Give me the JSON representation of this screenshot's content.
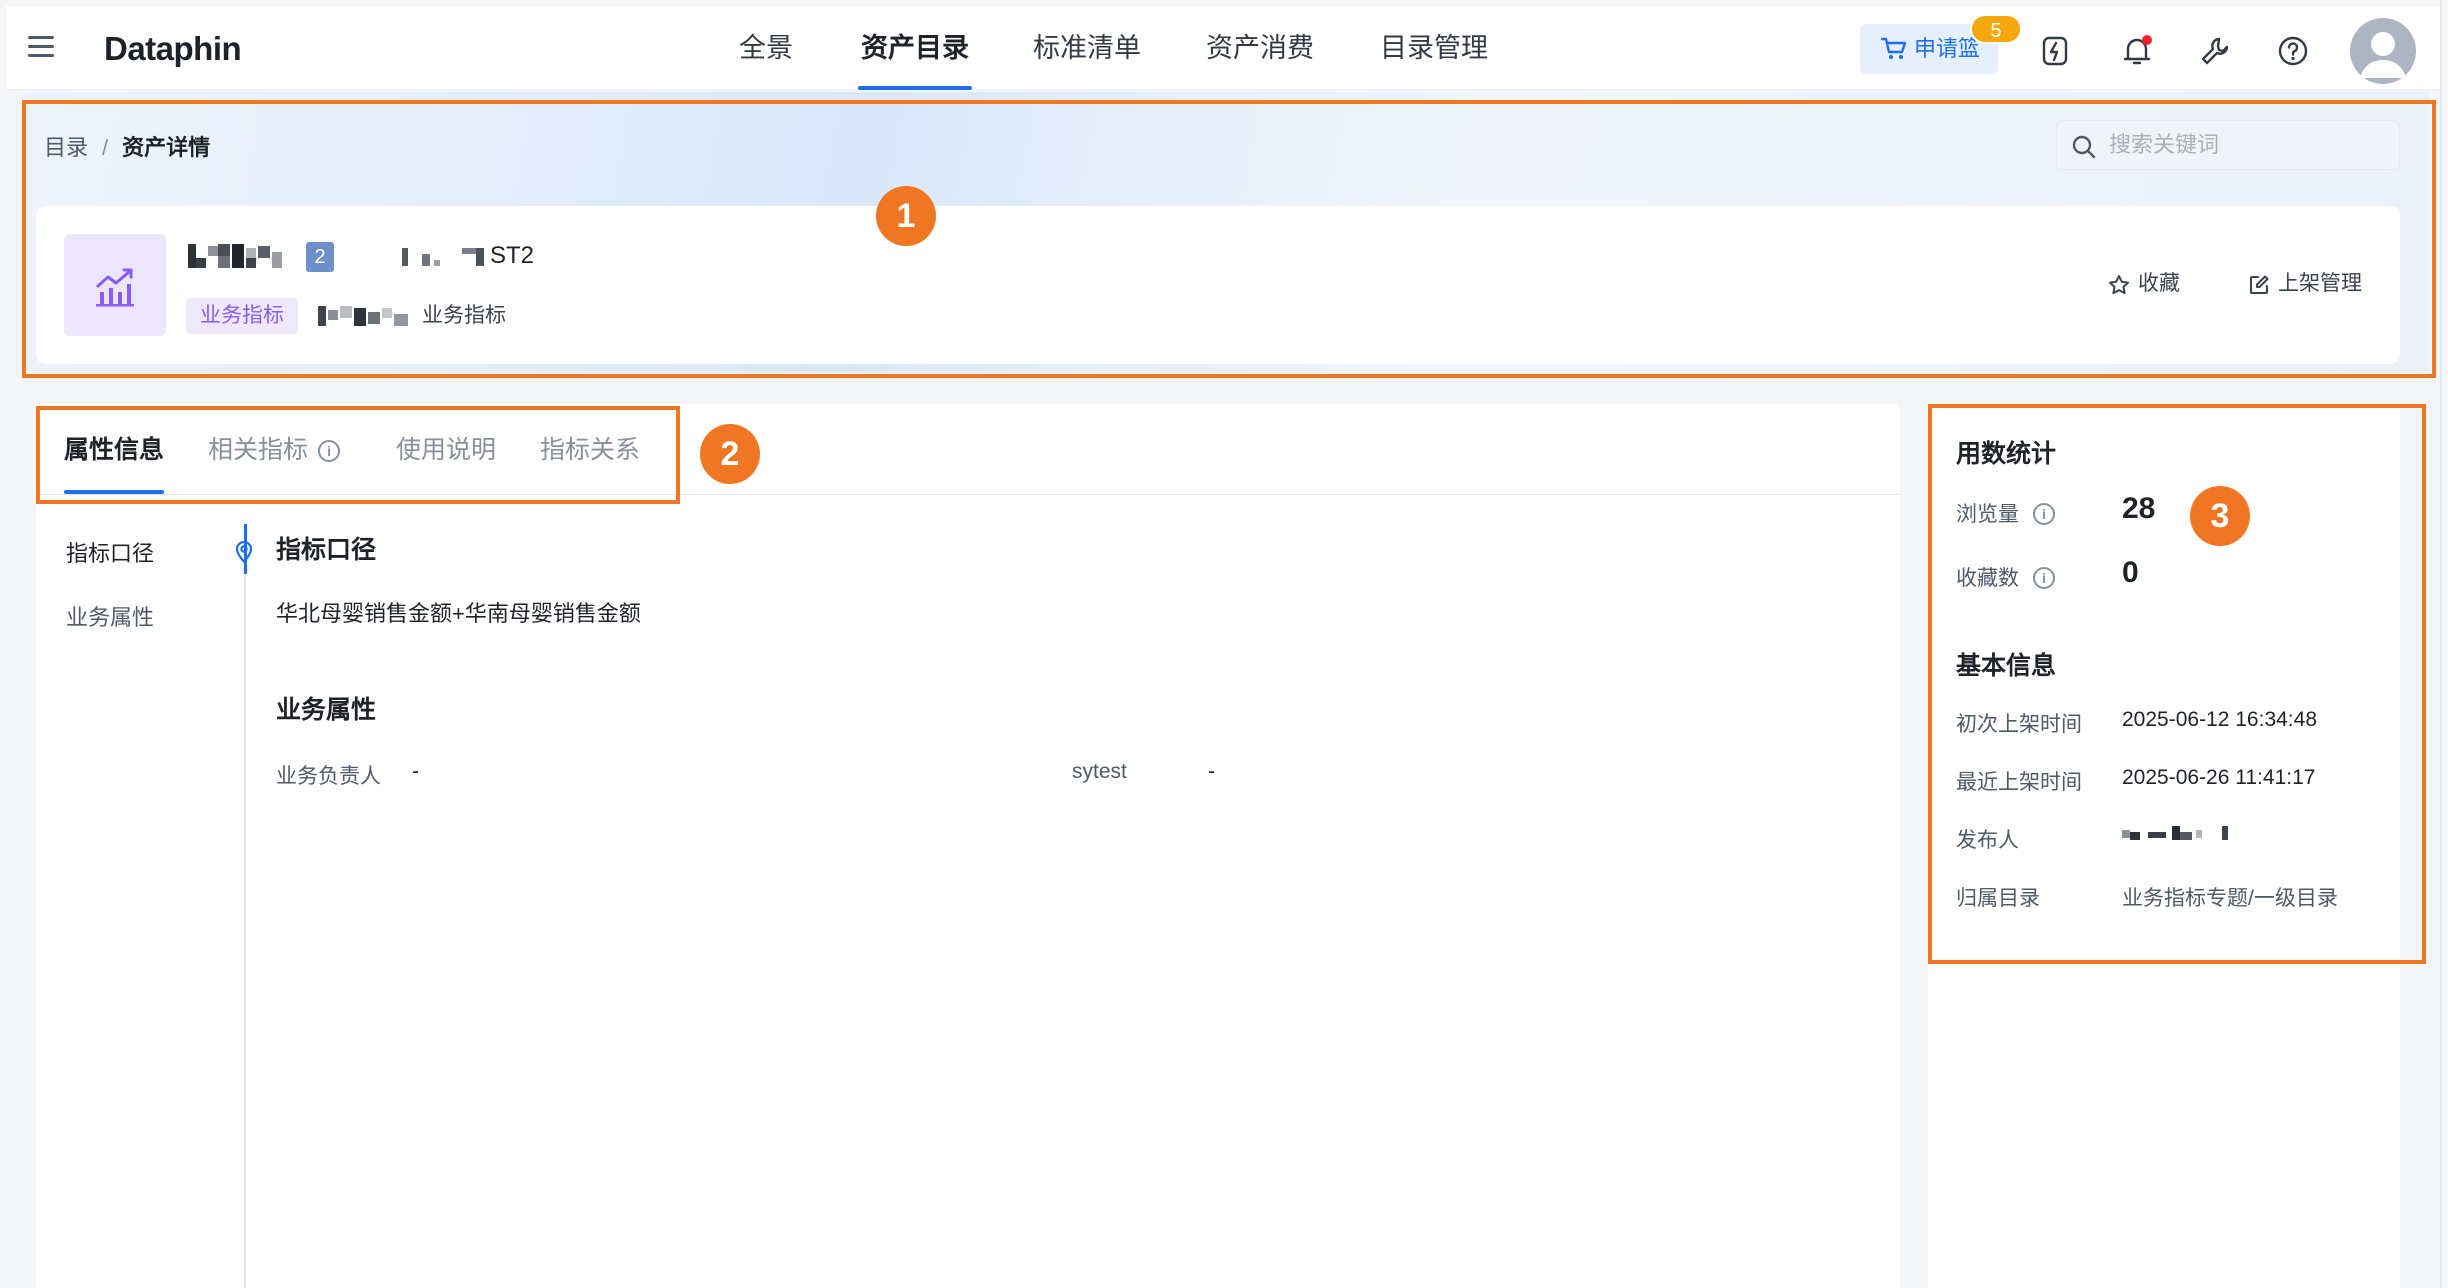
{
  "app": {
    "logo": "Dataphin",
    "nav": [
      "全景",
      "资产目录",
      "标准清单",
      "资产消费",
      "目录管理"
    ],
    "active_nav": "资产目录",
    "cart_label": "申请篮",
    "cart_count": "5"
  },
  "icons": {
    "menu": "hamburger-menu-icon",
    "cart": "cart-icon",
    "flash": "flash-doc-icon",
    "bell": "bell-icon",
    "tools": "wrench-icon",
    "help": "help-circle-icon",
    "search": "search-icon",
    "metric": "chart-bar-icon",
    "star": "star-icon",
    "edit": "edit-square-icon",
    "pin": "location-pin-icon",
    "info": "info-icon"
  },
  "header": {
    "breadcrumb": [
      "目录",
      "资产详情"
    ],
    "search_placeholder": "搜索关键词",
    "asset_name_suffix": "2",
    "asset_code": "ST2",
    "tag": "业务指标",
    "asset_type": "业务指标",
    "favorite_label": "收藏",
    "shelf_label": "上架管理"
  },
  "tabs": [
    {
      "label": "属性信息",
      "active": true
    },
    {
      "label": "相关指标",
      "info": true
    },
    {
      "label": "使用说明"
    },
    {
      "label": "指标关系"
    }
  ],
  "side_nav": [
    "指标口径",
    "业务属性"
  ],
  "content": {
    "section1_title": "指标口径",
    "section1_text": "华北母婴销售金额+华南母婴销售金额",
    "section2_title": "业务属性",
    "fields": [
      {
        "label": "业务负责人",
        "value": "-"
      },
      {
        "label": "sytest",
        "value": "-"
      }
    ]
  },
  "usage": {
    "title": "用数统计",
    "views_label": "浏览量",
    "views": "28",
    "favorites_label": "收藏数",
    "favorites": "0"
  },
  "basic": {
    "title": "基本信息",
    "first_listed_label": "初次上架时间",
    "first_listed": "2025-06-12 16:34:48",
    "last_listed_label": "最近上架时间",
    "last_listed": "2025-06-26 11:41:17",
    "publisher_label": "发布人",
    "directory_label": "归属目录",
    "directory": "业务指标专题/一级目录"
  },
  "annotations": [
    "1",
    "2",
    "3"
  ],
  "colors": {
    "accent": "#1d6ff2",
    "annotation": "#f07623",
    "badge": "#f5a70d",
    "tag_bg": "#efe8fc",
    "tag_fg": "#8a5cf1"
  }
}
